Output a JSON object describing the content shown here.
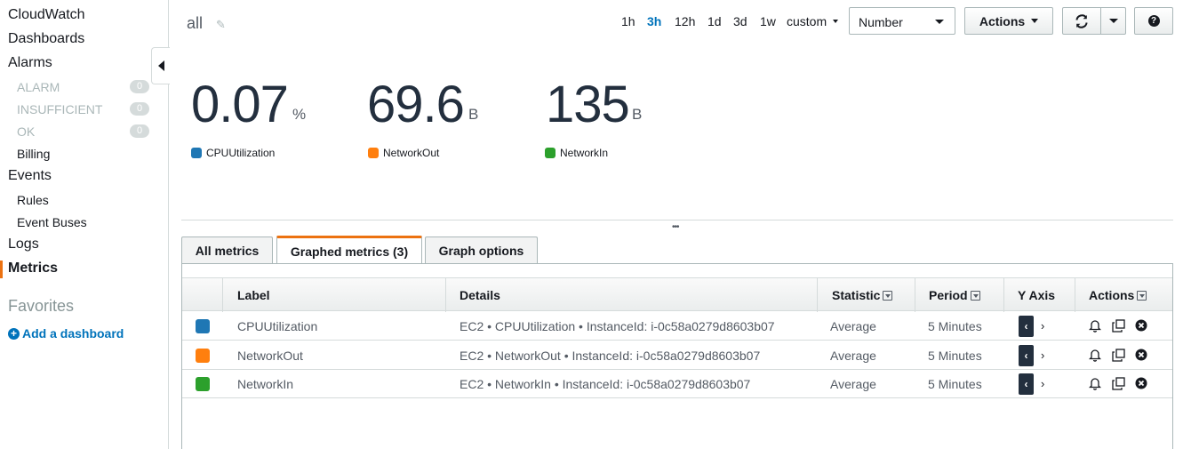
{
  "sidebar": {
    "cloudwatch": "CloudWatch",
    "dashboards": "Dashboards",
    "alarms": "Alarms",
    "alarm_items": [
      {
        "label": "ALARM",
        "count": "0"
      },
      {
        "label": "INSUFFICIENT",
        "count": "0"
      },
      {
        "label": "OK",
        "count": "0"
      }
    ],
    "billing": "Billing",
    "events": "Events",
    "rules": "Rules",
    "event_buses": "Event Buses",
    "logs": "Logs",
    "metrics": "Metrics",
    "favorites": "Favorites",
    "add_dashboard": "Add a dashboard"
  },
  "header": {
    "title": "all",
    "time_ranges": [
      "1h",
      "3h",
      "12h",
      "1d",
      "3d",
      "1w"
    ],
    "selected_range": "3h",
    "custom": "custom",
    "view_type": "Number",
    "actions": "Actions"
  },
  "widgets": [
    {
      "value": "0.07",
      "unit": "%",
      "metric": "CPUUtilization",
      "color": "#1f77b4"
    },
    {
      "value": "69.6",
      "unit": "B",
      "metric": "NetworkOut",
      "color": "#ff7f0e"
    },
    {
      "value": "135",
      "unit": "B",
      "metric": "NetworkIn",
      "color": "#2ca02c"
    }
  ],
  "tabs": [
    "All metrics",
    "Graphed metrics (3)",
    "Graph options"
  ],
  "active_tab": "Graphed metrics (3)",
  "table": {
    "columns": {
      "label": "Label",
      "details": "Details",
      "statistic": "Statistic",
      "period": "Period",
      "y_axis": "Y Axis",
      "actions": "Actions"
    },
    "rows": [
      {
        "color": "#1f77b4",
        "label": "CPUUtilization",
        "details": "EC2 • CPUUtilization • InstanceId: i-0c58a0279d8603b07",
        "statistic": "Average",
        "period": "5 Minutes"
      },
      {
        "color": "#ff7f0e",
        "label": "NetworkOut",
        "details": "EC2 • NetworkOut • InstanceId: i-0c58a0279d8603b07",
        "statistic": "Average",
        "period": "5 Minutes"
      },
      {
        "color": "#2ca02c",
        "label": "NetworkIn",
        "details": "EC2 • NetworkIn • InstanceId: i-0c58a0279d8603b07",
        "statistic": "Average",
        "period": "5 Minutes"
      }
    ]
  }
}
